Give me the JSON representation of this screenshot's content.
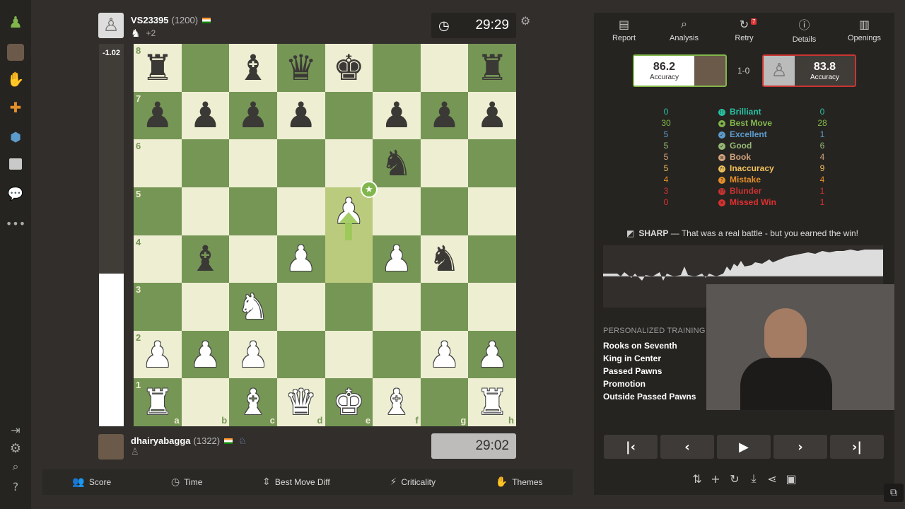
{
  "top_player": {
    "name": "VS23395",
    "rating": "(1200)",
    "material": "+2"
  },
  "bottom_player": {
    "name": "dhairyabagga",
    "rating": "(1322)"
  },
  "clocks": {
    "top": "29:29",
    "bottom": "29:02"
  },
  "eval": {
    "text": "-1.02",
    "white_fraction": 0.4
  },
  "board": {
    "coords_ranks": [
      "8",
      "7",
      "6",
      "5",
      "4",
      "3",
      "2",
      "1"
    ],
    "coords_files": [
      "a",
      "b",
      "c",
      "d",
      "e",
      "f",
      "g",
      "h"
    ],
    "position": [
      [
        "bR",
        "",
        "bB",
        "bQ",
        "bK",
        "",
        "",
        "bR"
      ],
      [
        "bP",
        "bP",
        "bP",
        "bP",
        "",
        "bP",
        "bP",
        "bP"
      ],
      [
        "",
        "",
        "",
        "",
        "",
        "bN",
        "",
        ""
      ],
      [
        "",
        "",
        "",
        "",
        "wP",
        "",
        "",
        ""
      ],
      [
        "",
        "bB",
        "",
        "wP",
        "",
        "wP",
        "bN",
        ""
      ],
      [
        "",
        "",
        "wN",
        "",
        "",
        "",
        "",
        ""
      ],
      [
        "wP",
        "wP",
        "wP",
        "",
        "",
        "",
        "wP",
        "wP"
      ],
      [
        "wR",
        "",
        "wB",
        "wQ",
        "wK",
        "wB",
        "",
        "wR"
      ]
    ],
    "highlight": [
      "e5",
      "e4"
    ]
  },
  "bottom_tabs": [
    {
      "label": "Score",
      "icon": "users-icon"
    },
    {
      "label": "Time",
      "icon": "clock-icon"
    },
    {
      "label": "Best Move Diff",
      "icon": "sort-icon"
    },
    {
      "label": "Criticality",
      "icon": "bolt-icon"
    },
    {
      "label": "Themes",
      "icon": "puzzle-icon"
    }
  ],
  "right_tabs": [
    {
      "label": "Report",
      "icon": "report-icon"
    },
    {
      "label": "Analysis",
      "icon": "magnifier-icon"
    },
    {
      "label": "Retry",
      "icon": "retry-icon",
      "badge": "7"
    },
    {
      "label": "Details",
      "icon": "info-icon"
    },
    {
      "label": "Openings",
      "icon": "book-icon"
    }
  ],
  "accuracy": {
    "white": "86.2",
    "black": "83.8",
    "label": "Accuracy",
    "result": "1-0"
  },
  "stats": [
    {
      "label": "Brilliant",
      "left": "0",
      "right": "0",
      "color": "#26c2a3",
      "sym": "!!"
    },
    {
      "label": "Best Move",
      "left": "30",
      "right": "28",
      "color": "#81b64c",
      "sym": "★"
    },
    {
      "label": "Excellent",
      "left": "5",
      "right": "1",
      "color": "#5c9ccc",
      "sym": "✓"
    },
    {
      "label": "Good",
      "left": "5",
      "right": "6",
      "color": "#95b776",
      "sym": "✓"
    },
    {
      "label": "Book",
      "left": "5",
      "right": "4",
      "color": "#d5a47d",
      "sym": "≡"
    },
    {
      "label": "Inaccuracy",
      "left": "5",
      "right": "9",
      "color": "#f0c15c",
      "sym": "?!"
    },
    {
      "label": "Mistake",
      "left": "4",
      "right": "4",
      "color": "#e58f2a",
      "sym": "?"
    },
    {
      "label": "Blunder",
      "left": "3",
      "right": "1",
      "color": "#ca3431",
      "sym": "??"
    },
    {
      "label": "Missed Win",
      "left": "0",
      "right": "1",
      "color": "#dd3131",
      "sym": "✕"
    }
  ],
  "summary": {
    "tag": "SHARP",
    "text": "— That was a real battle - but you earned the win!"
  },
  "training": {
    "title": "PERSONALIZED TRAINING",
    "items": [
      "Rooks on Seventh",
      "King in Center",
      "Passed Pawns",
      "Promotion",
      "Outside Passed Pawns"
    ]
  }
}
